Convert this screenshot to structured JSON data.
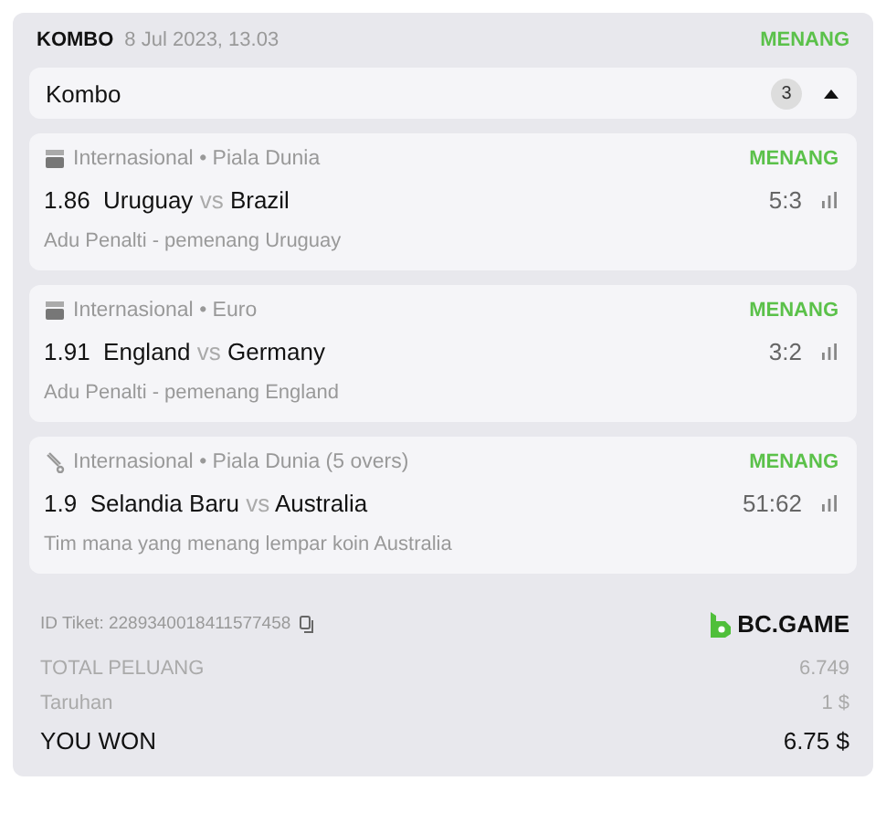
{
  "header": {
    "type": "KOMBO",
    "date": "8 Jul 2023, 13.03",
    "status": "MENANG"
  },
  "group": {
    "title": "Kombo",
    "count": "3",
    "expanded": true
  },
  "bets": [
    {
      "kind": "soccer",
      "category": "Internasional",
      "separator": "•",
      "league": "Piala Dunia",
      "status": "MENANG",
      "odds": "1.86",
      "home": "Uruguay",
      "vs": "vs",
      "away": "Brazil",
      "score": "5:3",
      "market": "Adu Penalti - pemenang Uruguay"
    },
    {
      "kind": "soccer",
      "category": "Internasional",
      "separator": "•",
      "league": "Euro",
      "status": "MENANG",
      "odds": "1.91",
      "home": "England",
      "vs": "vs",
      "away": "Germany",
      "score": "3:2",
      "market": "Adu Penalti - pemenang England"
    },
    {
      "kind": "cricket",
      "category": "Internasional",
      "separator": "•",
      "league": "Piala Dunia (5 overs)",
      "status": "MENANG",
      "odds": "1.9",
      "home": "Selandia Baru",
      "vs": "vs",
      "away": "Australia",
      "score": "51:62",
      "market": "Tim mana yang menang lempar koin Australia"
    }
  ],
  "ticket": {
    "label": "ID Tiket: 2289340018411577458",
    "brand": "BC.GAME"
  },
  "summary": [
    {
      "kind": "muted",
      "label": "TOTAL PELUANG",
      "value": "6.749"
    },
    {
      "kind": "muted",
      "label": "Taruhan",
      "value": "1 $"
    },
    {
      "kind": "total",
      "label": "YOU WON",
      "value": "6.75 $"
    }
  ]
}
